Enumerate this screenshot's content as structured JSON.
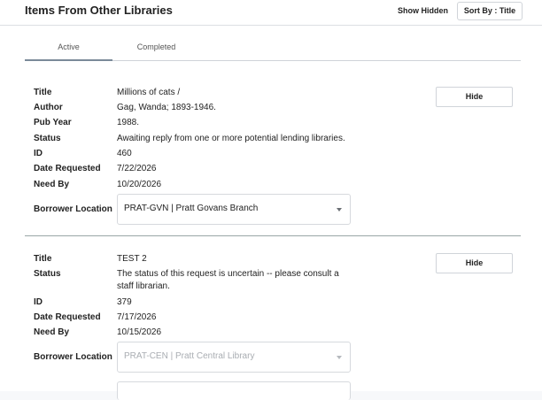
{
  "header": {
    "title": "Items From Other Libraries",
    "show_hidden_label": "Show Hidden",
    "sort_label": "Sort By : Title"
  },
  "tabs": [
    {
      "label": "Active",
      "selected": true
    },
    {
      "label": "Completed",
      "selected": false
    }
  ],
  "items": [
    {
      "fields": [
        {
          "label": "Title",
          "value": "Millions of cats /"
        },
        {
          "label": "Author",
          "value": "Gag, Wanda; 1893-1946."
        },
        {
          "label": "Pub Year",
          "value": "1988."
        },
        {
          "label": "Status",
          "value": "Awaiting reply from one or more potential lending libraries."
        },
        {
          "label": "ID",
          "value": "460"
        },
        {
          "label": "Date Requested",
          "value": "7/22/2026"
        },
        {
          "label": "Need By",
          "value": "10/20/2026"
        }
      ],
      "borrower_location_label": "Borrower Location",
      "borrower_location_value": "PRAT-GVN | Pratt Govans Branch",
      "borrower_location_disabled": false,
      "hide_label": "Hide"
    },
    {
      "fields": [
        {
          "label": "Title",
          "value": "TEST 2"
        },
        {
          "label": "Status",
          "value": "The status of this request is uncertain -- please consult a staff librarian."
        },
        {
          "label": "ID",
          "value": "379"
        },
        {
          "label": "Date Requested",
          "value": "7/17/2026"
        },
        {
          "label": "Need By",
          "value": "10/15/2026"
        }
      ],
      "borrower_location_label": "Borrower Location",
      "borrower_location_value": "PRAT-CEN | Pratt Central Library",
      "borrower_location_disabled": true,
      "hide_label": "Hide"
    }
  ]
}
